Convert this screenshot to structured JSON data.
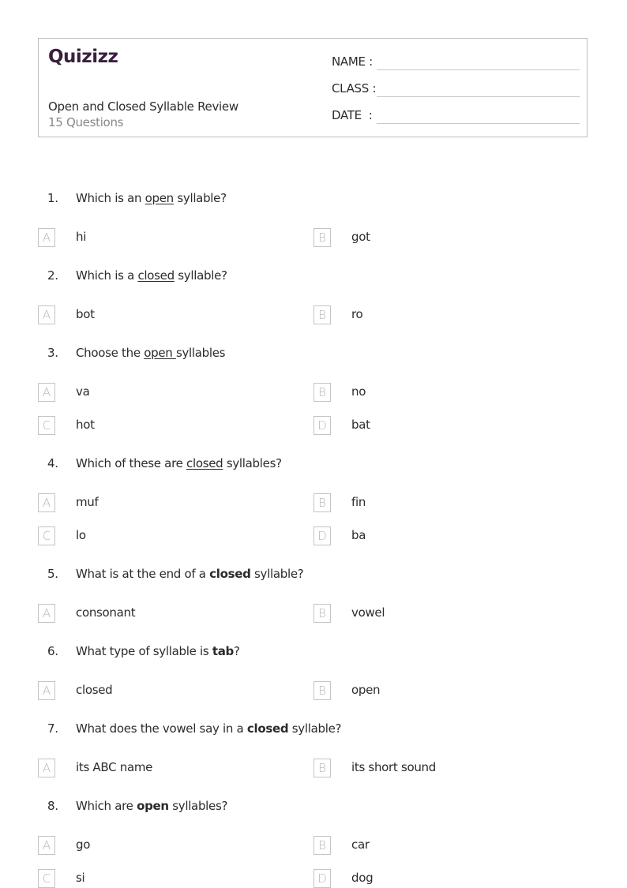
{
  "header": {
    "logo": "Quizizz",
    "title": "Open and Closed Syllable Review",
    "question_count": "15 Questions",
    "fields": [
      {
        "label": "NAME :"
      },
      {
        "label": "CLASS :"
      },
      {
        "label": "DATE  :"
      }
    ]
  },
  "questions": [
    {
      "number": "1.",
      "parts": [
        {
          "t": "Which is an ",
          "s": ""
        },
        {
          "t": "open",
          "s": "u"
        },
        {
          "t": " syllable?",
          "s": ""
        }
      ],
      "options": [
        {
          "letter": "A",
          "text": "hi"
        },
        {
          "letter": "B",
          "text": "got"
        }
      ]
    },
    {
      "number": "2.",
      "parts": [
        {
          "t": "Which is a ",
          "s": ""
        },
        {
          "t": "closed",
          "s": "u"
        },
        {
          "t": " syllable?",
          "s": ""
        }
      ],
      "options": [
        {
          "letter": "A",
          "text": "bot"
        },
        {
          "letter": "B",
          "text": "ro"
        }
      ]
    },
    {
      "number": "3.",
      "parts": [
        {
          "t": "Choose the ",
          "s": ""
        },
        {
          "t": "open ",
          "s": "u"
        },
        {
          "t": "syllables",
          "s": ""
        }
      ],
      "options": [
        {
          "letter": "A",
          "text": "va"
        },
        {
          "letter": "B",
          "text": "no"
        },
        {
          "letter": "C",
          "text": "hot"
        },
        {
          "letter": "D",
          "text": "bat"
        }
      ]
    },
    {
      "number": "4.",
      "parts": [
        {
          "t": "Which of these are ",
          "s": ""
        },
        {
          "t": "closed",
          "s": "u"
        },
        {
          "t": " syllables?",
          "s": ""
        }
      ],
      "options": [
        {
          "letter": "A",
          "text": "muf"
        },
        {
          "letter": "B",
          "text": "fin"
        },
        {
          "letter": "C",
          "text": "lo"
        },
        {
          "letter": "D",
          "text": "ba"
        }
      ]
    },
    {
      "number": "5.",
      "parts": [
        {
          "t": "What is at the end of a ",
          "s": ""
        },
        {
          "t": "closed",
          "s": "b"
        },
        {
          "t": " syllable?",
          "s": ""
        }
      ],
      "options": [
        {
          "letter": "A",
          "text": "consonant"
        },
        {
          "letter": "B",
          "text": "vowel"
        }
      ]
    },
    {
      "number": "6.",
      "parts": [
        {
          "t": "What type of syllable is ",
          "s": ""
        },
        {
          "t": "tab",
          "s": "b"
        },
        {
          "t": "?",
          "s": ""
        }
      ],
      "options": [
        {
          "letter": "A",
          "text": "closed"
        },
        {
          "letter": "B",
          "text": "open"
        }
      ]
    },
    {
      "number": "7.",
      "parts": [
        {
          "t": "What does the vowel say in a ",
          "s": ""
        },
        {
          "t": "closed",
          "s": "b"
        },
        {
          "t": " syllable?",
          "s": ""
        }
      ],
      "options": [
        {
          "letter": "A",
          "text": "its ABC name"
        },
        {
          "letter": "B",
          "text": "its short sound"
        }
      ]
    },
    {
      "number": "8.",
      "parts": [
        {
          "t": "Which are ",
          "s": ""
        },
        {
          "t": "open",
          "s": "b"
        },
        {
          "t": " syllables?",
          "s": ""
        }
      ],
      "options": [
        {
          "letter": "A",
          "text": "go"
        },
        {
          "letter": "B",
          "text": "car"
        },
        {
          "letter": "C",
          "text": "si"
        },
        {
          "letter": "D",
          "text": "dog"
        }
      ]
    }
  ]
}
